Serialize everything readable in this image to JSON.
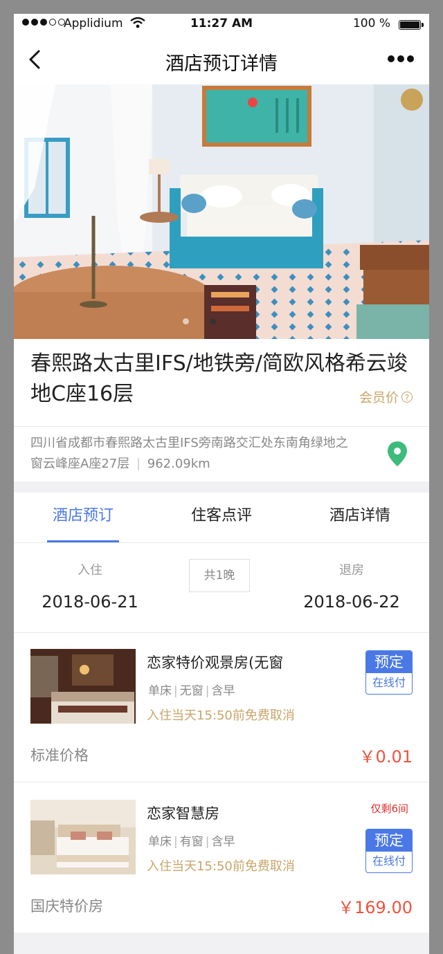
{
  "status_bar": {
    "carrier": "Applidium",
    "time": "11:27 AM",
    "battery": "100 %"
  },
  "nav": {
    "title": "酒店预订详情"
  },
  "hotel": {
    "title": "春熙路太古里IFS/地铁旁/简欧风格希云竣地C座16层",
    "member_price": "会员价",
    "help": "?",
    "address": "四川省成都市春熙路太古里IFS旁南路交汇处东南角绿地之窗云峰座A座27层",
    "address_sep": "|",
    "distance": "962.09km"
  },
  "tabs": [
    {
      "label": "酒店预订",
      "active": true
    },
    {
      "label": "住客点评",
      "active": false
    },
    {
      "label": "酒店详情",
      "active": false
    }
  ],
  "stay": {
    "checkin_label": "入住",
    "checkin_date": "2018-06-21",
    "nights": "共1晚",
    "checkout_label": "退房",
    "checkout_date": "2018-06-22"
  },
  "rooms": [
    {
      "name": "恋家特价观景房(无窗",
      "tags": [
        "单床",
        "无窗",
        "含早"
      ],
      "cancel": "入住当天15:50前免费取消",
      "remaining": "",
      "book_label": "预定",
      "pay_label": "在线付",
      "price_label": "标准价格",
      "price": "￥0.01"
    },
    {
      "name": "恋家智慧房",
      "tags": [
        "单床",
        "有窗",
        "含早"
      ],
      "cancel": "入住当天15:50前免费取消",
      "remaining": "仅剩6间",
      "book_label": "预定",
      "pay_label": "在线付",
      "price_label": "国庆特价房",
      "price": "￥169.00"
    }
  ],
  "colors": {
    "accent": "#4a78e6",
    "gold": "#c9a56a",
    "price": "#f0533c",
    "pin": "#3dbb7b"
  },
  "icons": [
    "back-chevron-icon",
    "more-dots-icon",
    "location-pin-icon",
    "question-circle-icon",
    "wifi-icon",
    "battery-icon"
  ]
}
